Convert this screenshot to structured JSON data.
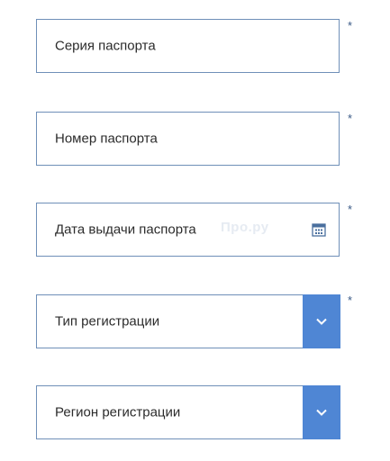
{
  "fields": {
    "passport_series": {
      "placeholder": "Серия паспорта",
      "required_mark": "*"
    },
    "passport_number": {
      "placeholder": "Номер паспорта",
      "required_mark": "*"
    },
    "passport_issue_date": {
      "placeholder": "Дата выдачи паспорта",
      "required_mark": "*",
      "icon": "calendar-icon"
    },
    "registration_type": {
      "placeholder": "Тип регистрации",
      "required_mark": "*",
      "icon": "chevron-down-icon"
    },
    "registration_region": {
      "placeholder": "Регион регистрации",
      "icon": "chevron-down-icon"
    }
  },
  "watermark": "Про.ру",
  "colors": {
    "border": "#6f8fb8",
    "dropdown_button": "#4f86d4",
    "text": "#2b2b2b",
    "required_mark": "#3a5a86"
  }
}
